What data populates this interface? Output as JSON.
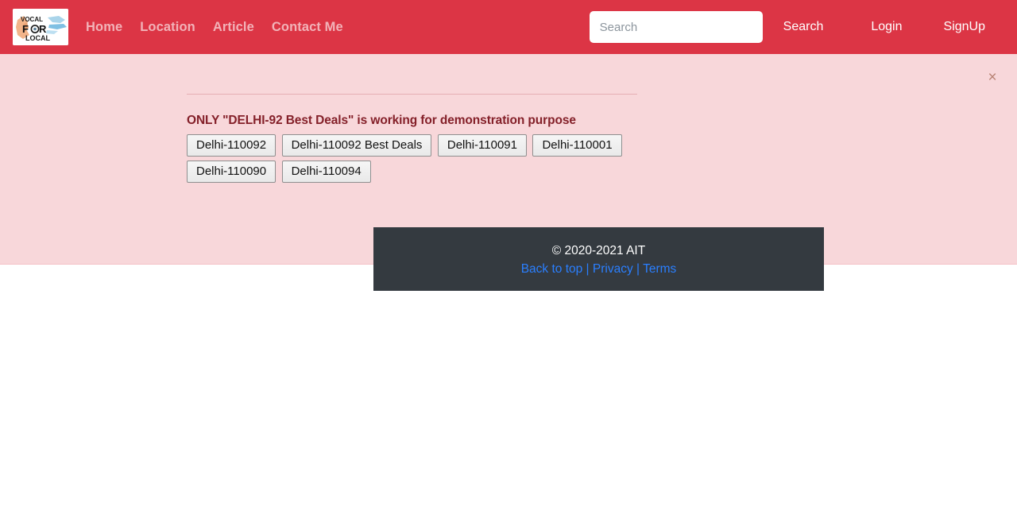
{
  "navbar": {
    "brand": {
      "icon": "vocal-for-local-logo",
      "line1": "VOCAL",
      "line2": "FOR",
      "line3": "LOCAL"
    },
    "links": [
      {
        "label": "Home"
      },
      {
        "label": "Location"
      },
      {
        "label": "Article"
      },
      {
        "label": "Contact Me"
      }
    ],
    "search": {
      "placeholder": "Search",
      "value": "",
      "button_label": "Search"
    },
    "login_label": "Login",
    "signup_label": "SignUp",
    "background_color": "#dc3545"
  },
  "alert": {
    "close_icon": "close-icon",
    "close_label": "×",
    "heading": "ONLY \"DELHI-92 Best Deals\" is working for demonstration purpose",
    "heading_color": "#842029",
    "background_color": "#f8d7da",
    "border_color": "#f5c2c7",
    "buttons": [
      {
        "label": "Delhi-110092"
      },
      {
        "label": "Delhi-110092 Best Deals"
      },
      {
        "label": "Delhi-110091"
      },
      {
        "label": "Delhi-110001"
      },
      {
        "label": "Delhi-110090"
      },
      {
        "label": "Delhi-110094"
      }
    ]
  },
  "footer": {
    "copyright": "© 2020-2021 AIT",
    "links": [
      {
        "label": "Back to top"
      },
      {
        "label": "Privacy"
      },
      {
        "label": "Terms"
      }
    ],
    "separator": "|",
    "background_color": "#343a40",
    "link_color": "#2a7fff"
  }
}
